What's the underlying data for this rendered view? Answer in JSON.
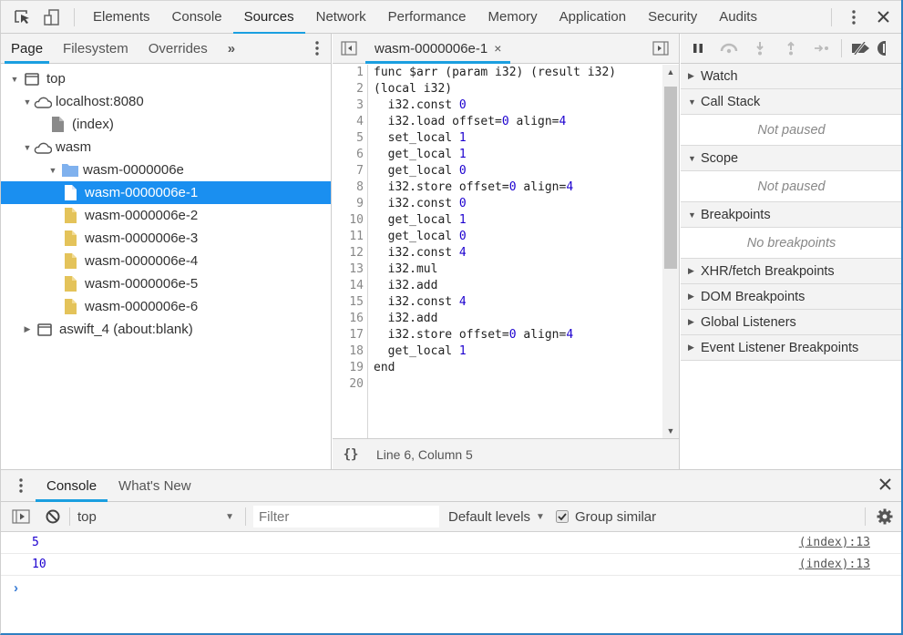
{
  "topbar": {
    "tabs": [
      "Elements",
      "Console",
      "Sources",
      "Network",
      "Performance",
      "Memory",
      "Application",
      "Security",
      "Audits"
    ],
    "active_tab": "Sources"
  },
  "navigator": {
    "tabs": [
      "Page",
      "Filesystem",
      "Overrides"
    ],
    "active_tab": "Page",
    "more": "»",
    "tree": [
      {
        "label": "top",
        "icon": "frame-icon",
        "expanded": true,
        "depth": 0
      },
      {
        "label": "localhost:8080",
        "icon": "cloud-icon",
        "expanded": true,
        "depth": 1
      },
      {
        "label": "(index)",
        "icon": "file-gray-icon",
        "depth": 2
      },
      {
        "label": "wasm",
        "icon": "cloud-icon",
        "expanded": true,
        "depth": 1
      },
      {
        "label": "wasm-0000006e",
        "icon": "folder-icon",
        "expanded": true,
        "depth": 2
      },
      {
        "label": "wasm-0000006e-1",
        "icon": "file-icon",
        "depth": 3,
        "selected": true
      },
      {
        "label": "wasm-0000006e-2",
        "icon": "file-icon",
        "depth": 3
      },
      {
        "label": "wasm-0000006e-3",
        "icon": "file-icon",
        "depth": 3
      },
      {
        "label": "wasm-0000006e-4",
        "icon": "file-icon",
        "depth": 3
      },
      {
        "label": "wasm-0000006e-5",
        "icon": "file-icon",
        "depth": 3
      },
      {
        "label": "wasm-0000006e-6",
        "icon": "file-icon",
        "depth": 3
      },
      {
        "label": "aswift_4 (about:blank)",
        "icon": "frame-icon",
        "expanded": false,
        "depth": 1
      }
    ]
  },
  "editor": {
    "file_tab": "wasm-0000006e-1",
    "close": "×",
    "lines": [
      [
        {
          "t": "func $arr (param i32) (result i32)"
        }
      ],
      [
        {
          "t": "(local i32)"
        }
      ],
      [
        {
          "t": "  i32.const "
        },
        {
          "n": "0"
        }
      ],
      [
        {
          "t": "  i32.load offset="
        },
        {
          "n": "0"
        },
        {
          "t": " align="
        },
        {
          "n": "4"
        }
      ],
      [
        {
          "t": "  set_local "
        },
        {
          "n": "1"
        }
      ],
      [
        {
          "t": "  get_local "
        },
        {
          "n": "1"
        }
      ],
      [
        {
          "t": "  get_local "
        },
        {
          "n": "0"
        }
      ],
      [
        {
          "t": "  i32.store offset="
        },
        {
          "n": "0"
        },
        {
          "t": " align="
        },
        {
          "n": "4"
        }
      ],
      [
        {
          "t": "  i32.const "
        },
        {
          "n": "0"
        }
      ],
      [
        {
          "t": "  get_local "
        },
        {
          "n": "1"
        }
      ],
      [
        {
          "t": "  get_local "
        },
        {
          "n": "0"
        }
      ],
      [
        {
          "t": "  i32.const "
        },
        {
          "n": "4"
        }
      ],
      [
        {
          "t": "  i32.mul"
        }
      ],
      [
        {
          "t": "  i32.add"
        }
      ],
      [
        {
          "t": "  i32.const "
        },
        {
          "n": "4"
        }
      ],
      [
        {
          "t": "  i32.add"
        }
      ],
      [
        {
          "t": "  i32.store offset="
        },
        {
          "n": "0"
        },
        {
          "t": " align="
        },
        {
          "n": "4"
        }
      ],
      [
        {
          "t": "  get_local "
        },
        {
          "n": "1"
        }
      ],
      [
        {
          "t": "end"
        }
      ],
      [
        {
          "t": ""
        }
      ]
    ],
    "status": "Line 6, Column 5",
    "pretty_print": "{}"
  },
  "debugger": {
    "panes": [
      {
        "title": "Watch",
        "expanded": false
      },
      {
        "title": "Call Stack",
        "expanded": true,
        "body": "Not paused"
      },
      {
        "title": "Scope",
        "expanded": true,
        "body": "Not paused"
      },
      {
        "title": "Breakpoints",
        "expanded": true,
        "body": "No breakpoints"
      },
      {
        "title": "XHR/fetch Breakpoints",
        "expanded": false
      },
      {
        "title": "DOM Breakpoints",
        "expanded": false
      },
      {
        "title": "Global Listeners",
        "expanded": false
      },
      {
        "title": "Event Listener Breakpoints",
        "expanded": false
      }
    ]
  },
  "drawer": {
    "tabs": [
      "Console",
      "What's New"
    ],
    "active_tab": "Console",
    "context": "top",
    "filter_placeholder": "Filter",
    "levels": "Default levels",
    "group_similar_label": "Group similar",
    "group_similar_checked": true,
    "messages": [
      {
        "value": "5",
        "source": "(index):13"
      },
      {
        "value": "10",
        "source": "(index):13"
      }
    ],
    "prompt": "›"
  },
  "colors": {
    "accent": "#1a9fe0",
    "selection": "#1a8ff0",
    "number": "#1c00cf",
    "folder": "#7fb1ee",
    "file": "#e4c35a"
  }
}
